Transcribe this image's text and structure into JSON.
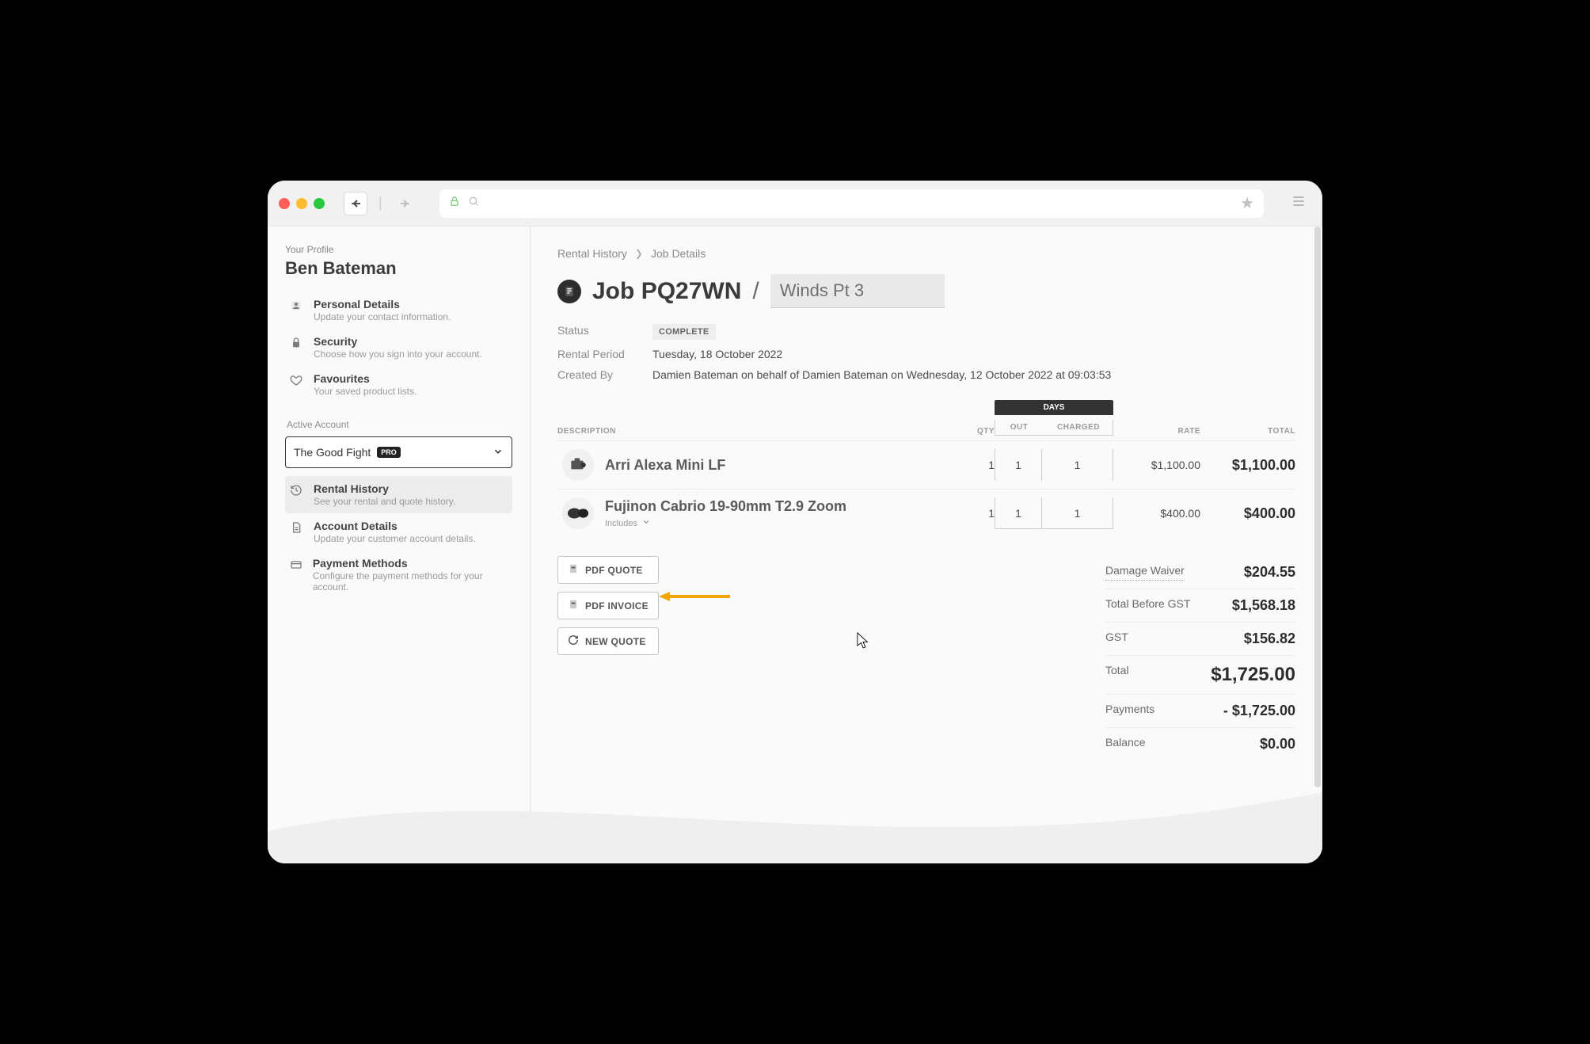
{
  "sidebar": {
    "your_profile_label": "Your Profile",
    "name": "Ben Bateman",
    "items": [
      {
        "title": "Personal Details",
        "sub": "Update your contact information."
      },
      {
        "title": "Security",
        "sub": "Choose how you sign into your account."
      },
      {
        "title": "Favourites",
        "sub": "Your saved product lists."
      }
    ],
    "active_account_label": "Active Account",
    "account": "The Good Fight",
    "account_badge": "PRO",
    "account_items": [
      {
        "title": "Rental History",
        "sub": "See your rental and quote history."
      },
      {
        "title": "Account Details",
        "sub": "Update your customer account details."
      },
      {
        "title": "Payment Methods",
        "sub": "Configure the payment methods for your account."
      }
    ]
  },
  "breadcrumb": {
    "a": "Rental History",
    "b": "Job Details"
  },
  "title": {
    "prefix": "Job",
    "code": "PQ27WN",
    "name": "Winds Pt 3"
  },
  "meta": {
    "status_label": "Status",
    "status_value": "COMPLETE",
    "period_label": "Rental Period",
    "period_value": "Tuesday, 18 October 2022",
    "created_label": "Created By",
    "created_value": "Damien Bateman on behalf of Damien Bateman on Wednesday, 12 October 2022 at 09:03:53"
  },
  "table": {
    "days_label": "DAYS",
    "headers": {
      "desc": "DESCRIPTION",
      "qty": "QTY",
      "out": "OUT",
      "charged": "CHARGED",
      "rate": "RATE",
      "total": "TOTAL"
    },
    "includes_label": "Includes",
    "items": [
      {
        "name": "Arri Alexa Mini LF",
        "qty": "1",
        "out": "1",
        "charged": "1",
        "rate": "$1,100.00",
        "total": "$1,100.00"
      },
      {
        "name": "Fujinon Cabrio 19-90mm T2.9 Zoom",
        "qty": "1",
        "out": "1",
        "charged": "1",
        "rate": "$400.00",
        "total": "$400.00",
        "has_includes": true
      }
    ]
  },
  "actions": {
    "pdf_quote": "PDF QUOTE",
    "pdf_invoice": "PDF INVOICE",
    "new_quote": "NEW QUOTE"
  },
  "totals": [
    {
      "k": "Damage Waiver",
      "v": "$204.55"
    },
    {
      "k": "Total Before GST",
      "v": "$1,568.18"
    },
    {
      "k": "GST",
      "v": "$156.82"
    },
    {
      "k": "Total",
      "v": "$1,725.00",
      "grand": true
    },
    {
      "k": "Payments",
      "v": "- $1,725.00"
    },
    {
      "k": "Balance",
      "v": "$0.00"
    }
  ]
}
